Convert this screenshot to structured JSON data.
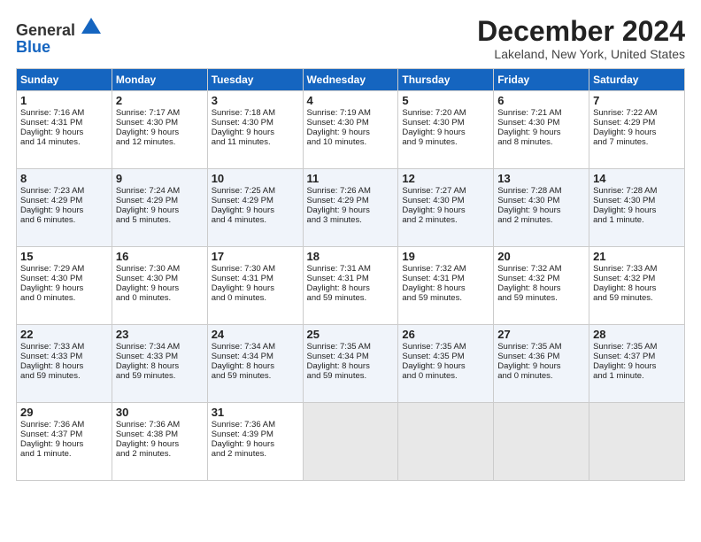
{
  "header": {
    "logo_line1": "General",
    "logo_line2": "Blue",
    "month": "December 2024",
    "location": "Lakeland, New York, United States"
  },
  "weekdays": [
    "Sunday",
    "Monday",
    "Tuesday",
    "Wednesday",
    "Thursday",
    "Friday",
    "Saturday"
  ],
  "weeks": [
    [
      {
        "day": "1",
        "lines": [
          "Sunrise: 7:16 AM",
          "Sunset: 4:31 PM",
          "Daylight: 9 hours",
          "and 14 minutes."
        ]
      },
      {
        "day": "2",
        "lines": [
          "Sunrise: 7:17 AM",
          "Sunset: 4:30 PM",
          "Daylight: 9 hours",
          "and 12 minutes."
        ]
      },
      {
        "day": "3",
        "lines": [
          "Sunrise: 7:18 AM",
          "Sunset: 4:30 PM",
          "Daylight: 9 hours",
          "and 11 minutes."
        ]
      },
      {
        "day": "4",
        "lines": [
          "Sunrise: 7:19 AM",
          "Sunset: 4:30 PM",
          "Daylight: 9 hours",
          "and 10 minutes."
        ]
      },
      {
        "day": "5",
        "lines": [
          "Sunrise: 7:20 AM",
          "Sunset: 4:30 PM",
          "Daylight: 9 hours",
          "and 9 minutes."
        ]
      },
      {
        "day": "6",
        "lines": [
          "Sunrise: 7:21 AM",
          "Sunset: 4:30 PM",
          "Daylight: 9 hours",
          "and 8 minutes."
        ]
      },
      {
        "day": "7",
        "lines": [
          "Sunrise: 7:22 AM",
          "Sunset: 4:29 PM",
          "Daylight: 9 hours",
          "and 7 minutes."
        ]
      }
    ],
    [
      {
        "day": "8",
        "lines": [
          "Sunrise: 7:23 AM",
          "Sunset: 4:29 PM",
          "Daylight: 9 hours",
          "and 6 minutes."
        ]
      },
      {
        "day": "9",
        "lines": [
          "Sunrise: 7:24 AM",
          "Sunset: 4:29 PM",
          "Daylight: 9 hours",
          "and 5 minutes."
        ]
      },
      {
        "day": "10",
        "lines": [
          "Sunrise: 7:25 AM",
          "Sunset: 4:29 PM",
          "Daylight: 9 hours",
          "and 4 minutes."
        ]
      },
      {
        "day": "11",
        "lines": [
          "Sunrise: 7:26 AM",
          "Sunset: 4:29 PM",
          "Daylight: 9 hours",
          "and 3 minutes."
        ]
      },
      {
        "day": "12",
        "lines": [
          "Sunrise: 7:27 AM",
          "Sunset: 4:30 PM",
          "Daylight: 9 hours",
          "and 2 minutes."
        ]
      },
      {
        "day": "13",
        "lines": [
          "Sunrise: 7:28 AM",
          "Sunset: 4:30 PM",
          "Daylight: 9 hours",
          "and 2 minutes."
        ]
      },
      {
        "day": "14",
        "lines": [
          "Sunrise: 7:28 AM",
          "Sunset: 4:30 PM",
          "Daylight: 9 hours",
          "and 1 minute."
        ]
      }
    ],
    [
      {
        "day": "15",
        "lines": [
          "Sunrise: 7:29 AM",
          "Sunset: 4:30 PM",
          "Daylight: 9 hours",
          "and 0 minutes."
        ]
      },
      {
        "day": "16",
        "lines": [
          "Sunrise: 7:30 AM",
          "Sunset: 4:30 PM",
          "Daylight: 9 hours",
          "and 0 minutes."
        ]
      },
      {
        "day": "17",
        "lines": [
          "Sunrise: 7:30 AM",
          "Sunset: 4:31 PM",
          "Daylight: 9 hours",
          "and 0 minutes."
        ]
      },
      {
        "day": "18",
        "lines": [
          "Sunrise: 7:31 AM",
          "Sunset: 4:31 PM",
          "Daylight: 8 hours",
          "and 59 minutes."
        ]
      },
      {
        "day": "19",
        "lines": [
          "Sunrise: 7:32 AM",
          "Sunset: 4:31 PM",
          "Daylight: 8 hours",
          "and 59 minutes."
        ]
      },
      {
        "day": "20",
        "lines": [
          "Sunrise: 7:32 AM",
          "Sunset: 4:32 PM",
          "Daylight: 8 hours",
          "and 59 minutes."
        ]
      },
      {
        "day": "21",
        "lines": [
          "Sunrise: 7:33 AM",
          "Sunset: 4:32 PM",
          "Daylight: 8 hours",
          "and 59 minutes."
        ]
      }
    ],
    [
      {
        "day": "22",
        "lines": [
          "Sunrise: 7:33 AM",
          "Sunset: 4:33 PM",
          "Daylight: 8 hours",
          "and 59 minutes."
        ]
      },
      {
        "day": "23",
        "lines": [
          "Sunrise: 7:34 AM",
          "Sunset: 4:33 PM",
          "Daylight: 8 hours",
          "and 59 minutes."
        ]
      },
      {
        "day": "24",
        "lines": [
          "Sunrise: 7:34 AM",
          "Sunset: 4:34 PM",
          "Daylight: 8 hours",
          "and 59 minutes."
        ]
      },
      {
        "day": "25",
        "lines": [
          "Sunrise: 7:35 AM",
          "Sunset: 4:34 PM",
          "Daylight: 8 hours",
          "and 59 minutes."
        ]
      },
      {
        "day": "26",
        "lines": [
          "Sunrise: 7:35 AM",
          "Sunset: 4:35 PM",
          "Daylight: 9 hours",
          "and 0 minutes."
        ]
      },
      {
        "day": "27",
        "lines": [
          "Sunrise: 7:35 AM",
          "Sunset: 4:36 PM",
          "Daylight: 9 hours",
          "and 0 minutes."
        ]
      },
      {
        "day": "28",
        "lines": [
          "Sunrise: 7:35 AM",
          "Sunset: 4:37 PM",
          "Daylight: 9 hours",
          "and 1 minute."
        ]
      }
    ],
    [
      {
        "day": "29",
        "lines": [
          "Sunrise: 7:36 AM",
          "Sunset: 4:37 PM",
          "Daylight: 9 hours",
          "and 1 minute."
        ]
      },
      {
        "day": "30",
        "lines": [
          "Sunrise: 7:36 AM",
          "Sunset: 4:38 PM",
          "Daylight: 9 hours",
          "and 2 minutes."
        ]
      },
      {
        "day": "31",
        "lines": [
          "Sunrise: 7:36 AM",
          "Sunset: 4:39 PM",
          "Daylight: 9 hours",
          "and 2 minutes."
        ]
      },
      null,
      null,
      null,
      null
    ]
  ]
}
